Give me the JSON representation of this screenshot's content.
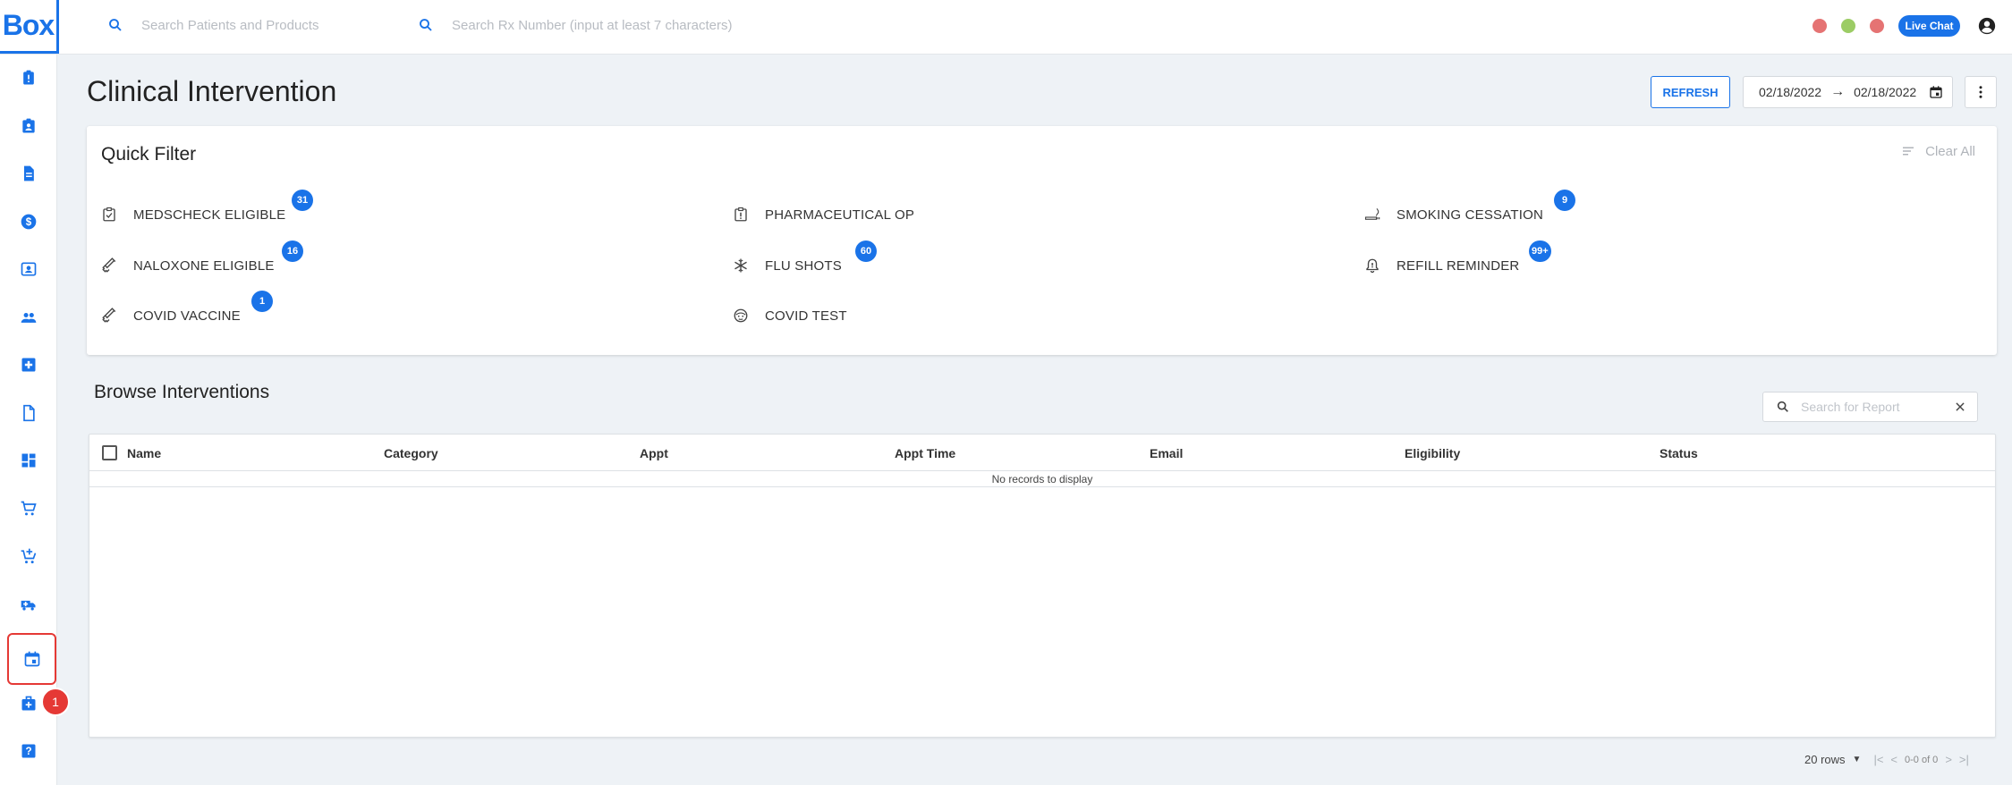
{
  "app": {
    "logo_text": "Box",
    "live_chat_label": "Live Chat",
    "status_dot_colors": [
      "#e57373",
      "#9ccc65",
      "#e57373"
    ]
  },
  "search": {
    "patients_placeholder": "Search Patients and Products",
    "rx_placeholder": "Search Rx Number (input at least 7 characters)"
  },
  "sidebar": {
    "items": [
      {
        "icon": "clipboard-alert-icon"
      },
      {
        "icon": "contact-card-icon"
      },
      {
        "icon": "document-icon"
      },
      {
        "icon": "dollar-circle-icon"
      },
      {
        "icon": "id-badge-icon"
      },
      {
        "icon": "people-icon"
      },
      {
        "icon": "medical-plus-icon"
      },
      {
        "icon": "file-icon"
      },
      {
        "icon": "dashboard-icon"
      },
      {
        "icon": "cart-icon"
      },
      {
        "icon": "cart-add-icon"
      },
      {
        "icon": "ambulance-icon"
      },
      {
        "icon": "calendar-icon",
        "active": true,
        "badge": "1"
      },
      {
        "icon": "medical-services-icon"
      },
      {
        "icon": "help-icon"
      }
    ],
    "active_badge": "1"
  },
  "page": {
    "title": "Clinical Intervention",
    "refresh_label": "REFRESH",
    "date_from": "02/18/2022",
    "date_arrow": "→",
    "date_to": "02/18/2022"
  },
  "quick_filter": {
    "title": "Quick Filter",
    "clear_all_label": "Clear All",
    "items": [
      {
        "label": "MEDSCHECK ELIGIBLE",
        "badge": "31",
        "icon": "checklist-icon"
      },
      {
        "label": "PHARMACEUTICAL OP",
        "badge": "",
        "icon": "alert-box-icon"
      },
      {
        "label": "SMOKING CESSATION",
        "badge": "9",
        "icon": "smoking-icon"
      },
      {
        "label": "NALOXONE ELIGIBLE",
        "badge": "16",
        "icon": "syringe-icon"
      },
      {
        "label": "FLU SHOTS",
        "badge": "60",
        "icon": "snowflake-icon"
      },
      {
        "label": "REFILL REMINDER",
        "badge": "99+",
        "icon": "bell-alert-icon"
      },
      {
        "label": "COVID VACCINE",
        "badge": "1",
        "icon": "vaccine-icon"
      },
      {
        "label": "COVID TEST",
        "badge": "",
        "icon": "face-mask-icon"
      }
    ]
  },
  "browse": {
    "title": "Browse Interventions",
    "search_placeholder": "Search for Report",
    "columns": [
      "Name",
      "Category",
      "Appt",
      "Appt Time",
      "Email",
      "Eligibility",
      "Status"
    ],
    "empty_message": "No records to display",
    "rows_per_page": "20 rows",
    "range_text": "0-0 of 0"
  }
}
